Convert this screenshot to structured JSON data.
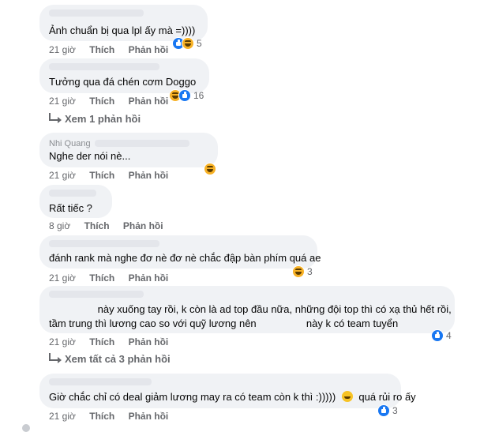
{
  "actions": {
    "like": "Thích",
    "reply": "Phản hồi"
  },
  "comments": [
    {
      "text": "Ảnh chuẩn bị qua lpl ấy mà =))))",
      "time": "21 giờ",
      "reactions": [
        "like",
        "haha"
      ],
      "count": "5"
    },
    {
      "text": "Tưởng qua đá chén cơm Doggo",
      "time": "21 giờ",
      "reactions": [
        "haha",
        "like"
      ],
      "count": "16",
      "replies_link": "Xem 1 phản hồi"
    },
    {
      "author_partial": "Nhi Quang",
      "text": "Nghe der nói nè...",
      "time": "21 giờ",
      "reactions": [
        "haha"
      ],
      "count": ""
    },
    {
      "text": "Rất tiếc ?",
      "time": "8 giờ",
      "reactions": [],
      "count": ""
    },
    {
      "text": "đánh rank mà nghe đơ nè đơ nè chắc đập bàn phím quá ae",
      "time": "21 giờ",
      "reactions": [
        "haha"
      ],
      "count": "3"
    },
    {
      "text_line1": "này xuống tay rồi, k còn là ad top đầu nữa, những đội top thì có xạ thủ hết rồi,",
      "text_line2a": "tầm trung thì lương cao so với quỹ lương nên",
      "text_line2b": "này k có team tuyển",
      "time": "21 giờ",
      "reactions": [
        "like"
      ],
      "count": "4",
      "replies_link": "Xem tất cả 3 phản hồi"
    },
    {
      "text_a": "Giờ chắc chỉ có deal giảm lương may ra có team còn k thì :)))))",
      "text_b": "quá rủi ro ấy",
      "time": "21 giờ",
      "reactions": [
        "like"
      ],
      "count": "3"
    }
  ],
  "colors": {
    "bubble": "#f0f2f5",
    "secondary_text": "#65676b",
    "like_blue": "#1877f2",
    "haha_yellow": "#f7b125"
  }
}
